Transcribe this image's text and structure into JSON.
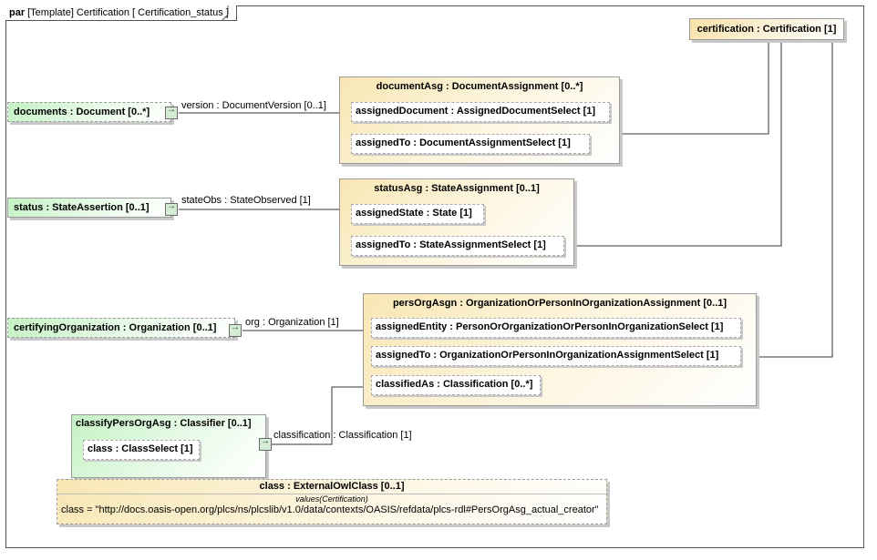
{
  "frame": {
    "kind": "par",
    "title": "[Template] Certification [ Certification_status ]"
  },
  "certification": {
    "label": "certification : Certification [1]"
  },
  "documents": {
    "label": "documents : Document [0..*]"
  },
  "status": {
    "label": "status : StateAssertion [0..1]"
  },
  "certifyingOrganization": {
    "label": "certifyingOrganization : Organization [0..1]"
  },
  "documentAsg": {
    "label": "documentAsg : DocumentAssignment [0..*]",
    "assignedDocument": "assignedDocument : AssignedDocumentSelect [1]",
    "assignedTo": "assignedTo : DocumentAssignmentSelect [1]"
  },
  "statusAsg": {
    "label": "statusAsg : StateAssignment [0..1]",
    "assignedState": "assignedState : State [1]",
    "assignedTo": "assignedTo : StateAssignmentSelect [1]"
  },
  "persOrgAsgn": {
    "label": "persOrgAsgn : OrganizationOrPersonInOrganizationAssignment [0..1]",
    "assignedEntity": "assignedEntity : PersonOrOrganizationOrPersonInOrganizationSelect [1]",
    "assignedTo": "assignedTo : OrganizationOrPersonInOrganizationAssignmentSelect [1]",
    "classifiedAs": "classifiedAs : Classification [0..*]"
  },
  "classifyPersOrgAsg": {
    "label": "classifyPersOrgAsg : Classifier [0..1]",
    "class": "class : ClassSelect [1]"
  },
  "externalOwlClass": {
    "label": "class : ExternalOwlClass [0..1]",
    "values_caption": "values(Certification)",
    "class_value": "class = \"http://docs.oasis-open.org/plcs/ns/plcslib/v1.0/data/contexts/OASIS/refdata/plcs-rdl#PersOrgAsg_actual_creator\""
  },
  "connectors": {
    "version": "version : DocumentVersion [0..1]",
    "stateObs": "stateObs : StateObserved [1]",
    "org": "org : Organization [1]",
    "classification": "classification : Classification [1]"
  }
}
